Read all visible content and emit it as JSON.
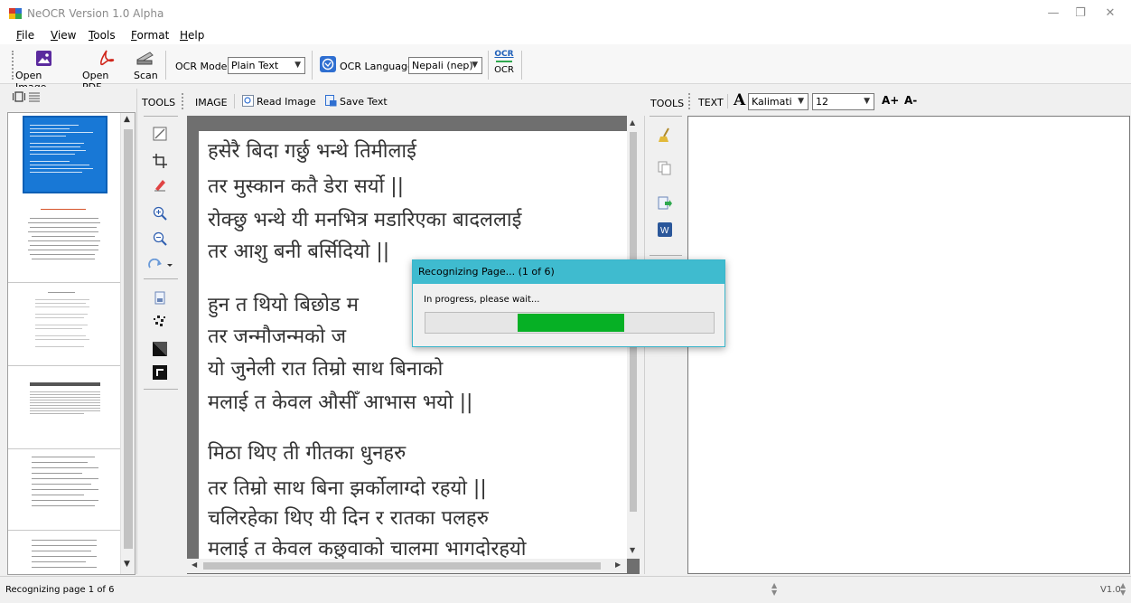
{
  "window": {
    "title": "NeOCR Version 1.0 Alpha",
    "minimize": "—",
    "maximize": "❐",
    "close": "✕"
  },
  "menu": [
    {
      "ul": "F",
      "rest": "ile"
    },
    {
      "ul": "V",
      "rest": "iew"
    },
    {
      "ul": "T",
      "rest": "ools"
    },
    {
      "ul": "F",
      "rest": "ormat"
    },
    {
      "ul": "H",
      "rest": "elp"
    }
  ],
  "toolbar": {
    "open_image": "Open Image",
    "open_pdf": "Open PDF",
    "scan": "Scan",
    "ocr_mode_label": "OCR Mode",
    "ocr_mode_value": "Plain Text",
    "ocr_language_label": "OCR Language",
    "ocr_language_value": "Nepali (nep)",
    "ocr_button": "OCR"
  },
  "image_panel": {
    "tools_label": "TOOLS",
    "image_label": "IMAGE",
    "read_image": "Read Image",
    "save_text": "Save Text",
    "lines": [
      "हसेरै बिदा गर्छु भन्थे तिमीलाई",
      "तर मुस्कान कतै डेरा सर्यो ||",
      "रोक्छु भन्थे यी मनभित्र मडारिएका बादललाई",
      "तर आशु बनी बर्सिदियो ||",
      "हुन त थियो बिछोड म",
      "तर जन्मौजन्मको ज",
      "यो जुनेली रात तिम्रो साथ बिनाको",
      "मलाई त केवल औसीँ आभास भयो ||",
      "मिठा थिए ती गीतका धुनहरु",
      "तर तिम्रो साथ बिना झर्कोलाग्दो रहयो ||",
      "चलिरहेका थिए यी दिन र रातका पलहरु",
      "मलाई त केवल कछुवाको चालमा भागदोरहयो"
    ]
  },
  "text_panel": {
    "tools_label": "TOOLS",
    "text_label": "TEXT",
    "font_value": "Kalimati",
    "size_value": "12",
    "grow": "A+",
    "shrink": "A-"
  },
  "dialog": {
    "title": "Recognizing Page... (1 of 6)",
    "message": "In progress, please wait...",
    "progress_start": 0.32,
    "progress_end": 0.69
  },
  "status": {
    "text": "Recognizing page 1 of 6",
    "version": "V1.0"
  },
  "icons": {
    "app": "app-icon",
    "open_image": "image-icon",
    "open_pdf": "pdf-icon",
    "scan": "scanner-icon",
    "ocr_language": "globe-icon",
    "read_image": "read-image-icon",
    "save_text": "save-text-icon"
  }
}
